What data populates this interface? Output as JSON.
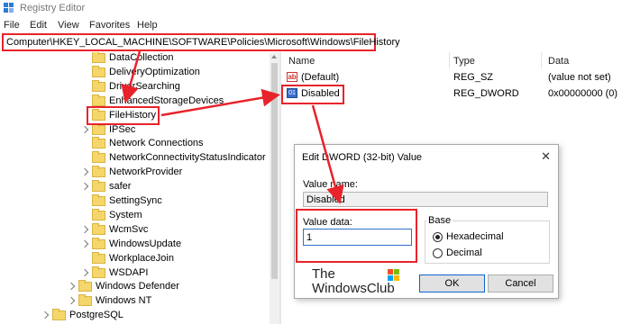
{
  "window": {
    "title": "Registry Editor"
  },
  "menu": [
    "File",
    "Edit",
    "View",
    "Favorites",
    "Help"
  ],
  "address": "Computer\\HKEY_LOCAL_MACHINE\\SOFTWARE\\Policies\\Microsoft\\Windows\\FileHistory",
  "tree": {
    "items": [
      {
        "label": "DataCollection",
        "expandable": false,
        "selected": false
      },
      {
        "label": "DeliveryOptimization",
        "expandable": false,
        "selected": false
      },
      {
        "label": "DriverSearching",
        "expandable": false,
        "selected": false
      },
      {
        "label": "EnhancedStorageDevices",
        "expandable": false,
        "selected": false
      },
      {
        "label": "FileHistory",
        "expandable": false,
        "selected": true
      },
      {
        "label": "IPSec",
        "expandable": true,
        "selected": false
      },
      {
        "label": "Network Connections",
        "expandable": false,
        "selected": false
      },
      {
        "label": "NetworkConnectivityStatusIndicator",
        "expandable": false,
        "selected": false
      },
      {
        "label": "NetworkProvider",
        "expandable": true,
        "selected": false
      },
      {
        "label": "safer",
        "expandable": true,
        "selected": false
      },
      {
        "label": "SettingSync",
        "expandable": false,
        "selected": false
      },
      {
        "label": "System",
        "expandable": false,
        "selected": false
      },
      {
        "label": "WcmSvc",
        "expandable": true,
        "selected": false
      },
      {
        "label": "WindowsUpdate",
        "expandable": true,
        "selected": false
      },
      {
        "label": "WorkplaceJoin",
        "expandable": false,
        "selected": false
      },
      {
        "label": "WSDAPI",
        "expandable": true,
        "selected": false
      }
    ],
    "parent_items": [
      {
        "label": "Windows Defender",
        "expandable": true
      },
      {
        "label": "Windows NT",
        "expandable": true
      }
    ],
    "root_items": [
      {
        "label": "PostgreSQL",
        "expandable": true
      }
    ]
  },
  "list": {
    "headers": {
      "name": "Name",
      "type": "Type",
      "data": "Data"
    },
    "rows": [
      {
        "icon": "string-value-icon",
        "name": "(Default)",
        "type": "REG_SZ",
        "data": "(value not set)"
      },
      {
        "icon": "binary-value-icon",
        "name": "Disabled",
        "type": "REG_DWORD",
        "data": "0x00000000 (0)"
      }
    ]
  },
  "dialog": {
    "title": "Edit DWORD (32-bit) Value",
    "close_glyph": "✕",
    "value_name_label": "Value name:",
    "value_name": "Disabled",
    "value_data_label": "Value data:",
    "value_data": "1",
    "base_label": "Base",
    "base_options": [
      {
        "label": "Hexadecimal",
        "selected": true
      },
      {
        "label": "Decimal",
        "selected": false
      }
    ],
    "ok_label": "OK",
    "cancel_label": "Cancel"
  },
  "watermark": {
    "line1": "The",
    "line2": "WindowsClub"
  },
  "colors": {
    "annotation_red": "#e8232b",
    "folder": "#f5d66b",
    "accent_blue": "#2d72c8"
  }
}
